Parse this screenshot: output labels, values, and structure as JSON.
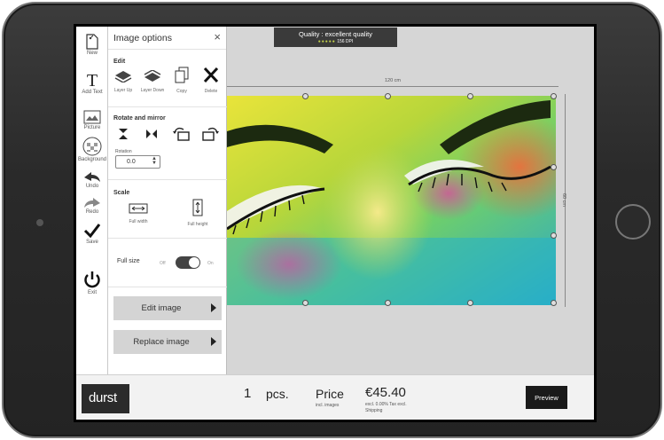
{
  "toolbar": {
    "new": "New",
    "add_text": "Add Text",
    "picture": "Picture",
    "background": "Background",
    "undo": "Undo",
    "redo": "Redo",
    "save": "Save",
    "exit": "Exit"
  },
  "panel": {
    "title": "Image options",
    "close": "×",
    "edit": {
      "title": "Edit",
      "layer_up": "Layer Up",
      "layer_down": "Layer Down",
      "copy": "Copy",
      "delete": "Delete"
    },
    "rotate": {
      "title": "Rotate and mirror",
      "rotation_label": "Rotation",
      "rotation_value": "0.0"
    },
    "scale": {
      "title": "Scale",
      "full_width": "Full width",
      "full_height": "Full height"
    },
    "full_size": {
      "label": "Full size",
      "off": "Off",
      "on": "On",
      "checked": true
    },
    "edit_image": "Edit image",
    "replace_image": "Replace image"
  },
  "canvas": {
    "quality_title": "Quality : excellent quality",
    "quality_dots": "●●●●●",
    "quality_dpi": "156 DPI",
    "width_dim": "120 cm",
    "height_dim": "60 cm"
  },
  "footer": {
    "logo": "durst",
    "quantity": "1",
    "quantity_unit": "pcs.",
    "price_label": "Price",
    "price_sub": "incl. images",
    "price_value": "€45.40",
    "price_tax": "excl. 0.00% Tax excl.",
    "price_shipping": "Shipping",
    "preview": "Preview"
  },
  "colors": {
    "accent": "#1a1a1a",
    "quality_dots": "#c3d14a",
    "panel_button": "#d4d4d4"
  }
}
